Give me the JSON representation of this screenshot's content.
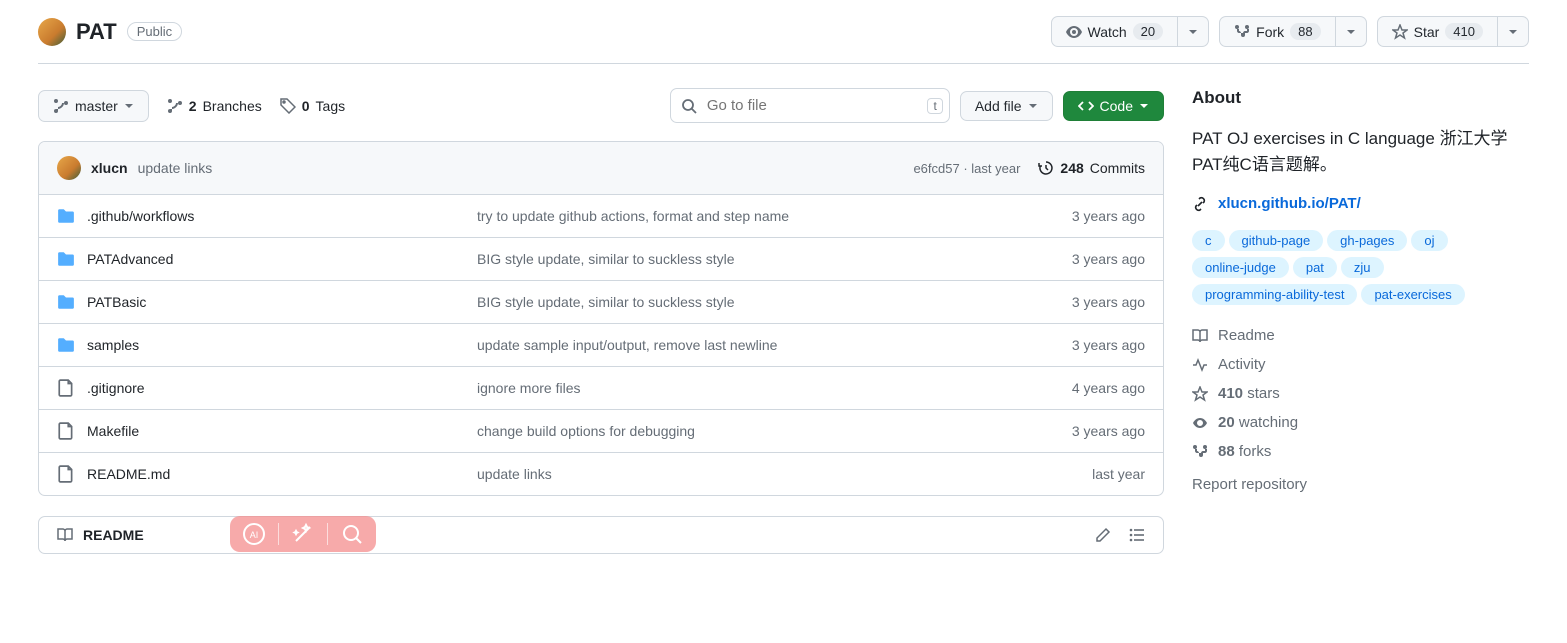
{
  "repo": {
    "name": "PAT",
    "visibility": "Public"
  },
  "actions": {
    "watch": {
      "label": "Watch",
      "count": "20"
    },
    "fork": {
      "label": "Fork",
      "count": "88"
    },
    "star": {
      "label": "Star",
      "count": "410"
    }
  },
  "branch": {
    "current": "master",
    "branchesCount": "2",
    "branchesLabel": "Branches",
    "tagsCount": "0",
    "tagsLabel": "Tags"
  },
  "search": {
    "placeholder": "Go to file",
    "kbd": "t"
  },
  "addFile": "Add file",
  "codeBtn": "Code",
  "latestCommit": {
    "author": "xlucn",
    "message": "update links",
    "sha": "e6fcd57",
    "date": "last year"
  },
  "commits": {
    "count": "248",
    "label": "Commits"
  },
  "files": [
    {
      "type": "folder",
      "name": ".github/workflows",
      "msg": "try to update github actions, format and step name",
      "date": "3 years ago"
    },
    {
      "type": "folder",
      "name": "PATAdvanced",
      "msg": "BIG style update, similar to suckless style",
      "date": "3 years ago"
    },
    {
      "type": "folder",
      "name": "PATBasic",
      "msg": "BIG style update, similar to suckless style",
      "date": "3 years ago"
    },
    {
      "type": "folder",
      "name": "samples",
      "msg": "update sample input/output, remove last newline",
      "date": "3 years ago"
    },
    {
      "type": "file",
      "name": ".gitignore",
      "msg": "ignore more files",
      "date": "4 years ago"
    },
    {
      "type": "file",
      "name": "Makefile",
      "msg": "change build options for debugging",
      "date": "3 years ago"
    },
    {
      "type": "file",
      "name": "README.md",
      "msg": "update links",
      "date": "last year"
    }
  ],
  "readme": {
    "label": "README"
  },
  "about": {
    "title": "About",
    "desc": "PAT OJ exercises in C language 浙江大学PAT纯C语言题解。",
    "url": "xlucn.github.io/PAT/",
    "topics": [
      "c",
      "github-page",
      "gh-pages",
      "oj",
      "online-judge",
      "pat",
      "zju",
      "programming-ability-test",
      "pat-exercises"
    ],
    "meta": {
      "readme": "Readme",
      "activity": "Activity",
      "stars": {
        "count": "410",
        "label": "stars"
      },
      "watching": {
        "count": "20",
        "label": "watching"
      },
      "forks": {
        "count": "88",
        "label": "forks"
      }
    },
    "report": "Report repository"
  }
}
